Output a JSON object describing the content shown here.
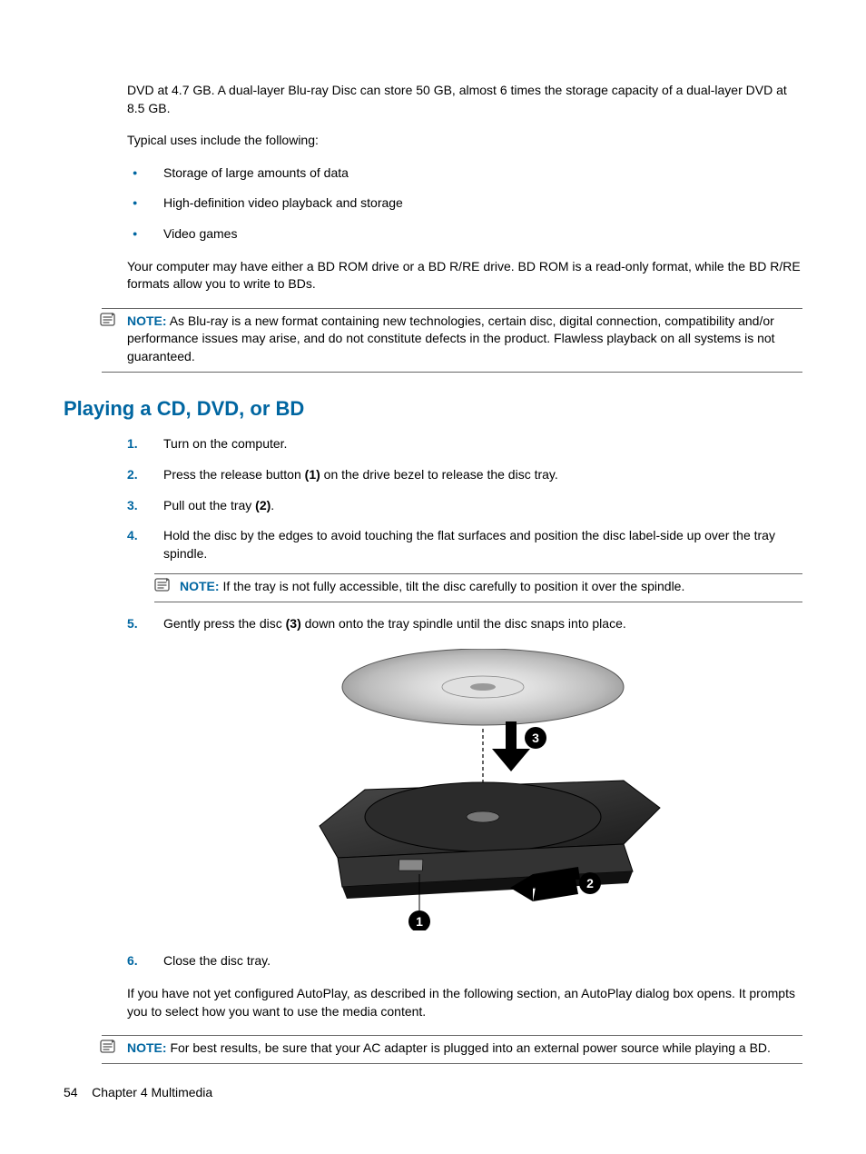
{
  "intro": {
    "p1": "DVD at 4.7 GB. A dual-layer Blu-ray Disc can store 50 GB, almost 6 times the storage capacity of a dual-layer DVD at 8.5 GB.",
    "p2": "Typical uses include the following:",
    "bullets": [
      "Storage of large amounts of data",
      "High-definition video playback and storage",
      "Video games"
    ],
    "p3": "Your computer may have either a BD ROM drive or a BD R/RE drive. BD ROM is a read-only format, while the BD R/RE formats allow you to write to BDs."
  },
  "note1": {
    "label": "NOTE:",
    "text": "As Blu-ray is a new format containing new technologies, certain disc, digital connection, compatibility and/or performance issues may arise, and do not constitute defects in the product. Flawless playback on all systems is not guaranteed."
  },
  "heading": "Playing a CD, DVD, or BD",
  "steps": {
    "s1": {
      "num": "1.",
      "text": "Turn on the computer."
    },
    "s2": {
      "num": "2.",
      "pre": "Press the release button ",
      "bold": "(1)",
      "post": " on the drive bezel to release the disc tray."
    },
    "s3": {
      "num": "3.",
      "pre": "Pull out the tray ",
      "bold": "(2)",
      "post": "."
    },
    "s4": {
      "num": "4.",
      "text": "Hold the disc by the edges to avoid touching the flat surfaces and position the disc label-side up over the tray spindle."
    },
    "s4note": {
      "label": "NOTE:",
      "text": "If the tray is not fully accessible, tilt the disc carefully to position it over the spindle."
    },
    "s5": {
      "num": "5.",
      "pre": "Gently press the disc ",
      "bold": "(3)",
      "post": " down onto the tray spindle until the disc snaps into place."
    },
    "s6": {
      "num": "6.",
      "text": "Close the disc tray."
    }
  },
  "after": "If you have not yet configured AutoPlay, as described in the following section, an AutoPlay dialog box opens. It prompts you to select how you want to use the media content.",
  "note2": {
    "label": "NOTE:",
    "text": "For best results, be sure that your AC adapter is plugged into an external power source while playing a BD."
  },
  "callouts": {
    "c1": "1",
    "c2": "2",
    "c3": "3"
  },
  "footer": {
    "page": "54",
    "chapter": "Chapter 4   Multimedia"
  }
}
